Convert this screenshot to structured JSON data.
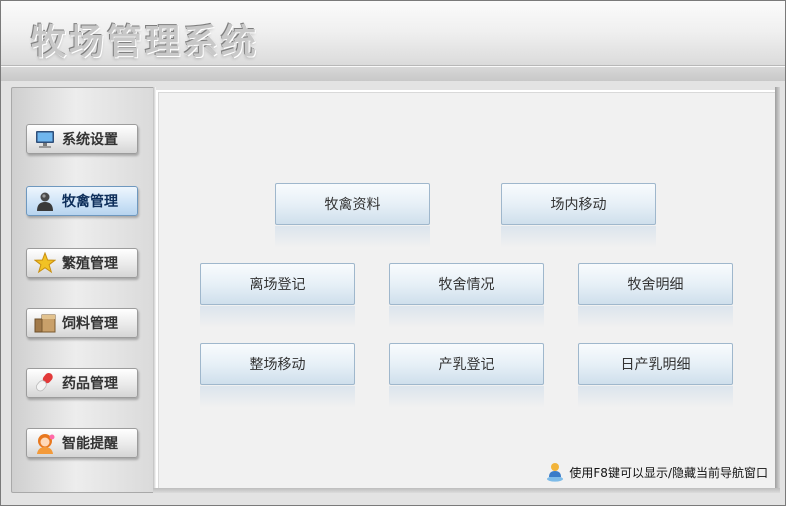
{
  "app": {
    "title": "牧场管理系统"
  },
  "sidebar": {
    "items": [
      {
        "label": "系统设置",
        "icon": "monitor-icon"
      },
      {
        "label": "牧禽管理",
        "icon": "user-icon",
        "active": true
      },
      {
        "label": "繁殖管理",
        "icon": "star-icon"
      },
      {
        "label": "饲料管理",
        "icon": "feed-box-icon"
      },
      {
        "label": "药品管理",
        "icon": "pill-icon"
      },
      {
        "label": "智能提醒",
        "icon": "assistant-girl-icon"
      }
    ]
  },
  "main": {
    "buttons": [
      {
        "label": "牧禽资料"
      },
      {
        "label": "场内移动"
      },
      {
        "label": "离场登记"
      },
      {
        "label": "牧舍情况"
      },
      {
        "label": "牧舍明细"
      },
      {
        "label": "整场移动"
      },
      {
        "label": "产乳登记"
      },
      {
        "label": "日产乳明细"
      }
    ]
  },
  "hint": {
    "text": "使用F8键可以显示/隐藏当前导航窗口",
    "icon": "pin-user-icon"
  },
  "colors": {
    "active_nav": "#b7d4ef",
    "button_face": "#e7f0f7",
    "button_border": "#9fb7cc"
  }
}
